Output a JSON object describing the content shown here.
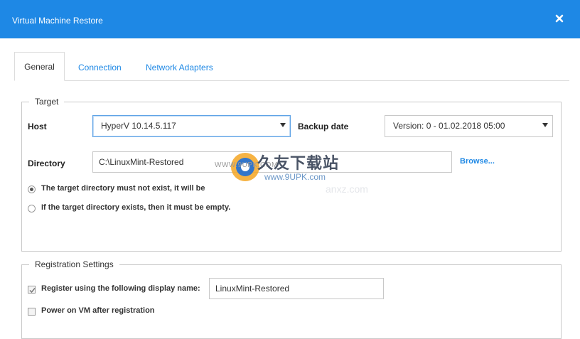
{
  "window": {
    "title": "Virtual Machine Restore",
    "close_icon": "close-icon"
  },
  "tabs": [
    {
      "label": "General",
      "active": true
    },
    {
      "label": "Connection",
      "active": false
    },
    {
      "label": "Network Adapters",
      "active": false
    }
  ],
  "target": {
    "legend": "Target",
    "host_label": "Host",
    "host_value": "HyperV 10.14.5.117",
    "backup_date_label": "Backup date",
    "backup_date_value": "Version: 0 - 01.02.2018 05:00",
    "directory_label": "Directory",
    "directory_value": "C:\\LinuxMint-Restored",
    "browse_label": "Browse...",
    "options": [
      {
        "text": "The target directory must not exist, it will be",
        "checked": true
      },
      {
        "text": "If the target directory exists, then it must be empty.",
        "checked": false
      }
    ]
  },
  "registration": {
    "legend": "Registration Settings",
    "register_label": "Register using the following display name:",
    "register_checked": true,
    "display_name_value": "LinuxMint-Restored",
    "power_on_label": "Power on VM after registration",
    "power_on_checked": false
  },
  "watermark": {
    "site_text": "WWW.9UPK.COM",
    "brand_text": "久友下载站",
    "url_text": "www.9UPK.com",
    "faded_text": "anxz.com"
  },
  "colors": {
    "accent": "#1e88e5",
    "title_bar": "#1e88e5",
    "border": "#c9c9c9"
  }
}
